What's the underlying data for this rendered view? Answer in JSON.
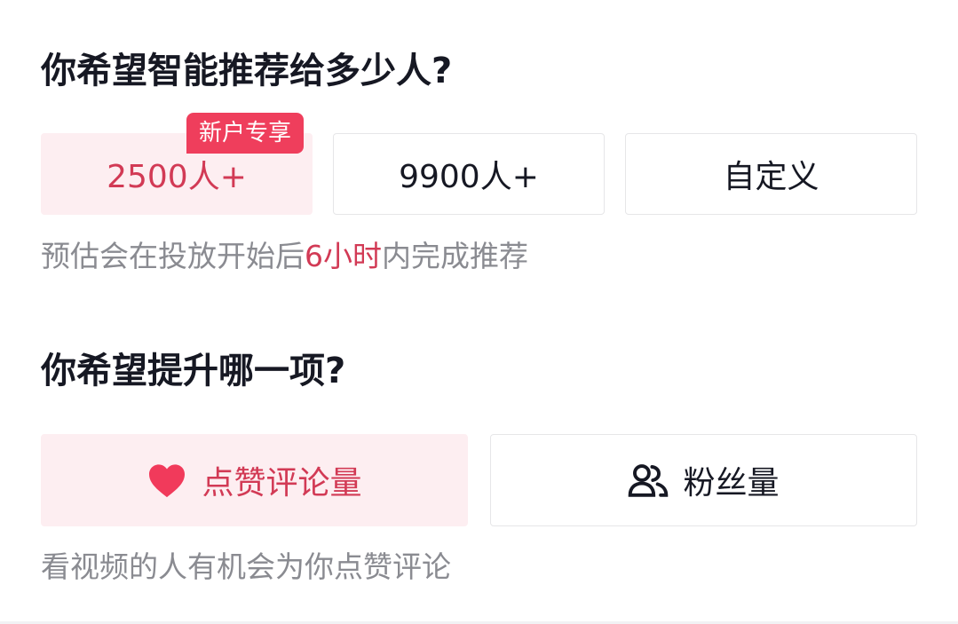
{
  "section_reach": {
    "title": "你希望智能推荐给多少人?",
    "badge": "新户专享",
    "options": [
      {
        "label": "2500人+",
        "selected": true
      },
      {
        "label": "9900人+",
        "selected": false
      },
      {
        "label": "自定义",
        "selected": false
      }
    ],
    "hint_prefix": "预估会在投放开始后",
    "hint_highlight": "6小时",
    "hint_suffix": "内完成推荐"
  },
  "section_goal": {
    "title": "你希望提升哪一项?",
    "options": [
      {
        "label": "点赞评论量",
        "icon": "heart-icon",
        "selected": true
      },
      {
        "label": "粉丝量",
        "icon": "users-icon",
        "selected": false
      }
    ],
    "hint": "看视频的人有机会为你点赞评论"
  },
  "colors": {
    "accent": "#d23a55",
    "badge_bg": "#ef3e5c",
    "selected_bg": "#fdeef1",
    "hint_text": "#8a8b91"
  }
}
